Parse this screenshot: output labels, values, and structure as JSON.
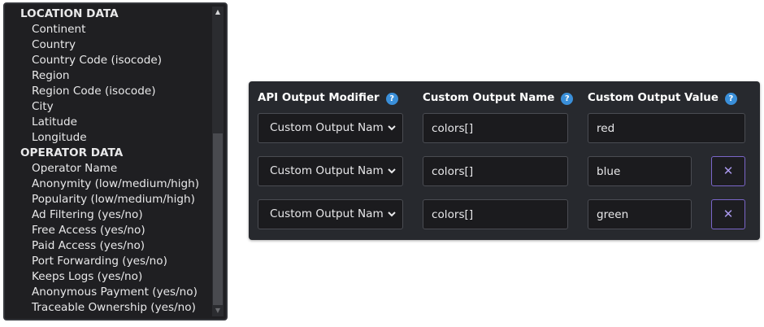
{
  "listbox": {
    "groups": [
      {
        "label": "LOCATION DATA",
        "options": [
          "Continent",
          "Country",
          "Country Code (isocode)",
          "Region",
          "Region Code (isocode)",
          "City",
          "Latitude",
          "Longitude"
        ]
      },
      {
        "label": "OPERATOR DATA",
        "options": [
          "Operator Name",
          "Anonymity (low/medium/high)",
          "Popularity (low/medium/high)",
          "Ad Filtering (yes/no)",
          "Free Access (yes/no)",
          "Paid Access (yes/no)",
          "Port Forwarding (yes/no)",
          "Keeps Logs (yes/no)",
          "Anonymous Payment (yes/no)",
          "Traceable Ownership (yes/no)"
        ]
      }
    ],
    "scrollbar": {
      "up_glyph": "▲",
      "down_glyph": "▼"
    }
  },
  "modifiers": {
    "headers": {
      "modifier": "API Output Modifier",
      "name": "Custom Output Name",
      "value": "Custom Output Value",
      "help_glyph": "?"
    },
    "rows": [
      {
        "modifier": "Custom Output Name",
        "name": "colors[]",
        "value": "red",
        "removable": false
      },
      {
        "modifier": "Custom Output Name",
        "name": "colors[]",
        "value": "blue",
        "removable": true
      },
      {
        "modifier": "Custom Output Name",
        "name": "colors[]",
        "value": "green",
        "removable": true
      }
    ],
    "remove_glyph": "✕"
  },
  "colors": {
    "panel_bg": "#27292e",
    "field_bg": "#1b1b1e",
    "help_icon": "#3a8fd9",
    "remove_accent": "#7a66c9"
  }
}
